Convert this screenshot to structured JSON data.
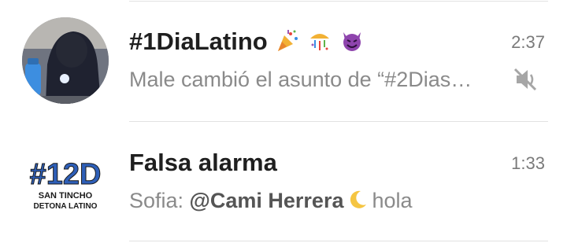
{
  "chats": [
    {
      "title": "#1DiaLatino",
      "title_emoji_icons": [
        "party-popper-icon",
        "confetti-ball-icon",
        "smiling-devil-icon"
      ],
      "time": "2:37",
      "preview": "Male cambió el asunto de “#2Dias…",
      "muted_icon": "muted-speaker-icon"
    },
    {
      "title": "Falsa alarma",
      "time": "1:33",
      "preview_sender": "Sofia: ",
      "preview_mention": "@Cami Herrera",
      "preview_emoji_icon": "crescent-moon-icon",
      "preview_text": "hola",
      "avatar_text_line1": "#12D",
      "avatar_text_line2": "SAN TINCHO",
      "avatar_text_line3": "DETONA LATINO"
    }
  ],
  "colors": {
    "title": "#1f1f1f",
    "preview": "#8a8a8a",
    "time": "#7a7a7a",
    "divider": "#e2e2e2",
    "background": "#ffffff"
  }
}
